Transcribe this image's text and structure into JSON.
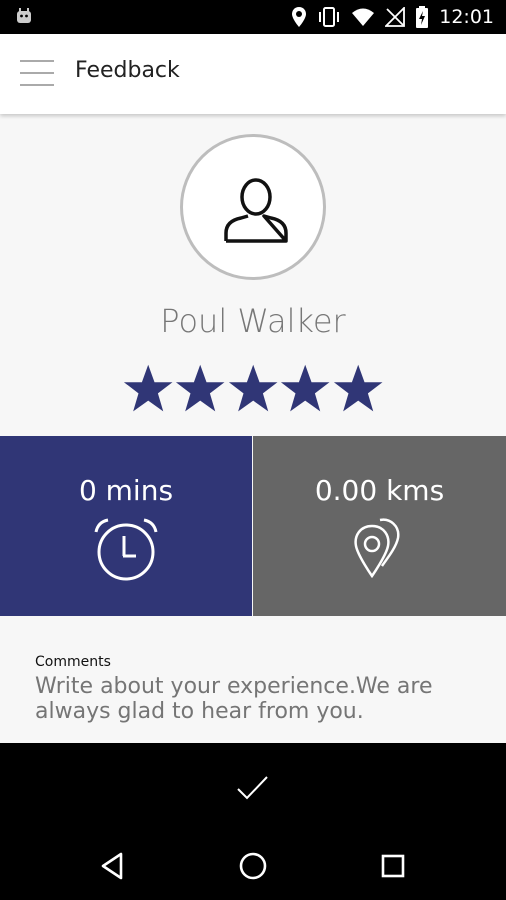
{
  "status_bar": {
    "time": "12:01",
    "icons": [
      "android-icon",
      "location-icon",
      "vibrate-icon",
      "wifi-icon",
      "no-signal-icon",
      "battery-charging-icon"
    ]
  },
  "app_bar": {
    "title": "Feedback",
    "menu_icon": "hamburger-menu-icon"
  },
  "driver": {
    "name": "Poul Walker",
    "avatar_icon": "person-icon",
    "rating": 5,
    "max_rating": 5
  },
  "stats": {
    "time_value": "0 mins",
    "time_icon": "alarm-clock-icon",
    "distance_value": "0.00 kms",
    "distance_icon": "map-pins-icon"
  },
  "comments": {
    "label": "Comments",
    "placeholder": "Write about your experience.We are always glad to hear from you."
  },
  "submit": {
    "icon": "checkmark-icon"
  },
  "nav_bar": {
    "icons": [
      "back-triangle-icon",
      "home-circle-icon",
      "recents-square-icon"
    ]
  },
  "colors": {
    "accent": "#303676",
    "star": "#303676",
    "distance_box": "#666666",
    "background": "#f7f7f7"
  }
}
